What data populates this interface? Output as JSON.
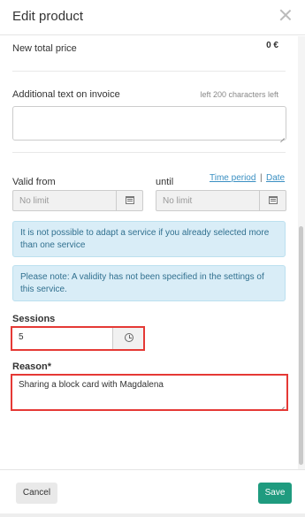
{
  "modal": {
    "title": "Edit product"
  },
  "pricing": {
    "new_total_label": "New total price",
    "new_total_value": "0 €"
  },
  "invoice": {
    "label": "Additional text on invoice",
    "chars_left": "left 200 characters left",
    "value": ""
  },
  "validity": {
    "from_label": "Valid from",
    "until_label": "until",
    "from_placeholder": "No limit",
    "until_placeholder": "No limit",
    "time_period_link": "Time period",
    "separator": "|",
    "date_link": "Date"
  },
  "alerts": {
    "service_adapt": "It is not possible to adapt a service if you already selected more than one service",
    "validity_note": "Please note: A validity has not been specified in the settings of this service."
  },
  "sessions": {
    "label": "Sessions",
    "value": "5"
  },
  "reason": {
    "label": "Reason*",
    "value": "Sharing a block card with Magdalena"
  },
  "footer": {
    "cancel_label": "Cancel",
    "save_label": "Save"
  },
  "colors": {
    "save_button": "#1f9b7f",
    "link": "#3a8fc2",
    "info_alert_bg": "#d9edf7",
    "highlight_frame": "#e53935"
  },
  "icons": {
    "close": "close-icon",
    "calendar": "calendar-icon",
    "clock": "clock-icon"
  }
}
